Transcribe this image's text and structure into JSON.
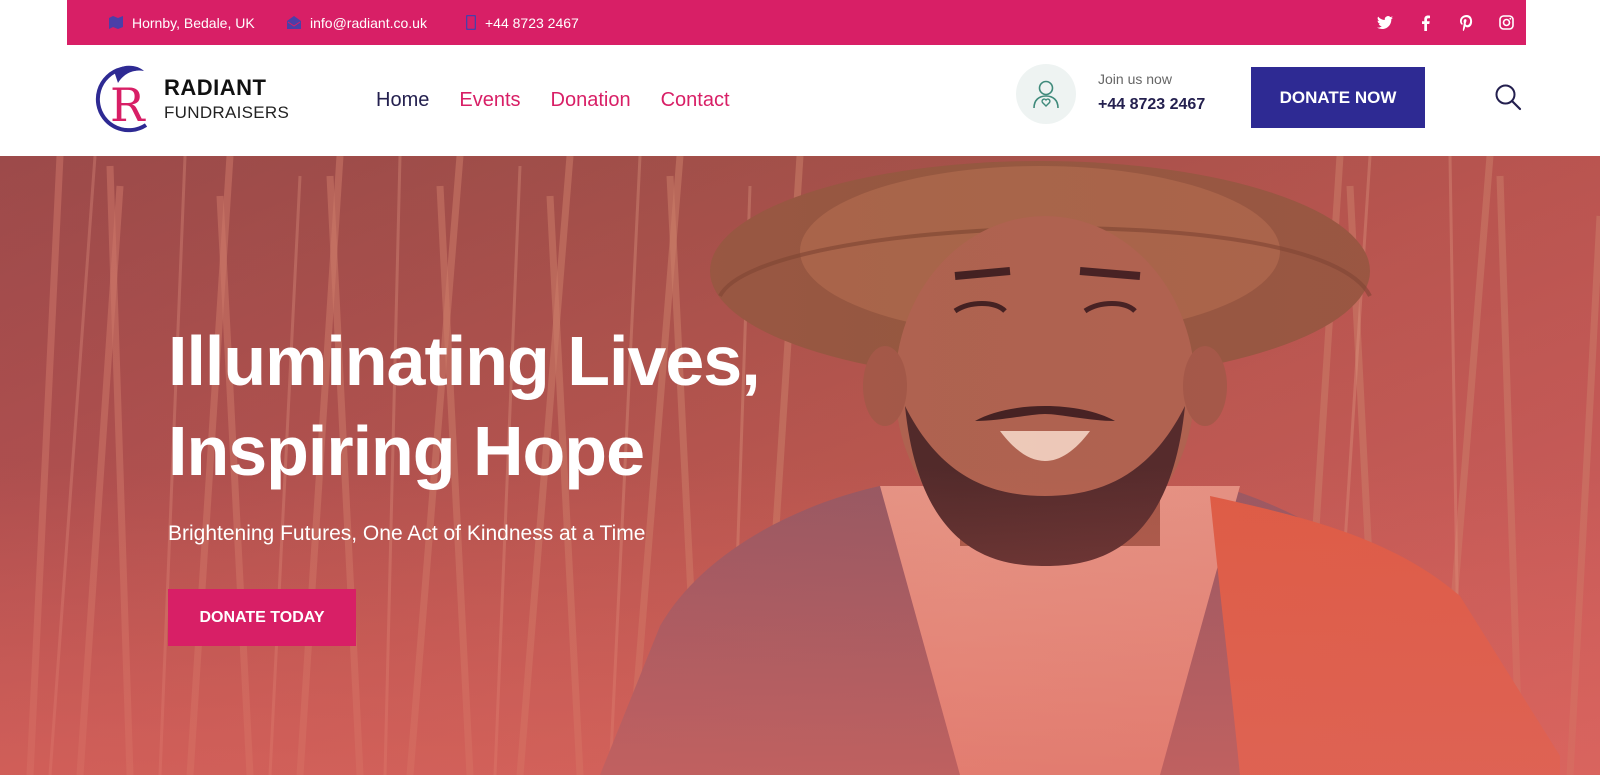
{
  "topbar": {
    "address": "Hornby, Bedale, UK",
    "email": "info@radiant.co.uk",
    "phone": "+44 8723 2467",
    "social": [
      "twitter-icon",
      "facebook-icon",
      "pinterest-icon",
      "instagram-icon"
    ]
  },
  "logo": {
    "letter": "R",
    "name": "RADIANT",
    "sub": "FUNDRAISERS"
  },
  "nav": {
    "items": [
      "Home",
      "Events",
      "Donation",
      "Contact"
    ]
  },
  "join": {
    "label": "Join us now",
    "phone": "+44 8723 2467"
  },
  "header": {
    "cta": "DONATE NOW"
  },
  "hero": {
    "title_line1": "Illuminating Lives,",
    "title_line2": "Inspiring Hope",
    "subtitle": "Brightening Futures, One Act of Kindness at a Time",
    "cta": "DONATE TODAY"
  },
  "colors": {
    "primary": "#d81f66",
    "navy": "#2e2a93",
    "text_dark": "#24204f"
  }
}
